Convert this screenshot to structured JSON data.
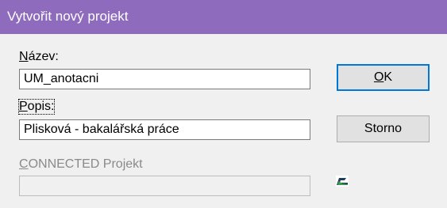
{
  "window": {
    "title": "Vytvořit nový projekt"
  },
  "form": {
    "name_label_mnemonic": "N",
    "name_label_rest": "ázev:",
    "name_value": "UM_anotacni",
    "description_label_mnemonic": "P",
    "description_label_rest": "opis:",
    "description_value": "Plisková - bakalářská práce",
    "connected_label_mnemonic": "C",
    "connected_label_rest": "ONNECTED Projekt",
    "connected_value": ""
  },
  "buttons": {
    "ok_mnemonic": "O",
    "ok_rest": "K",
    "cancel_label": "Storno"
  },
  "icons": {
    "connected": "connected-project-icon"
  },
  "colors": {
    "titlebar": "#8e6bbd",
    "dialog_bg": "#f0f0f0",
    "default_button_border": "#0078d7",
    "icon_dark": "#1e3f5a",
    "icon_accent": "#3c9a4a"
  }
}
